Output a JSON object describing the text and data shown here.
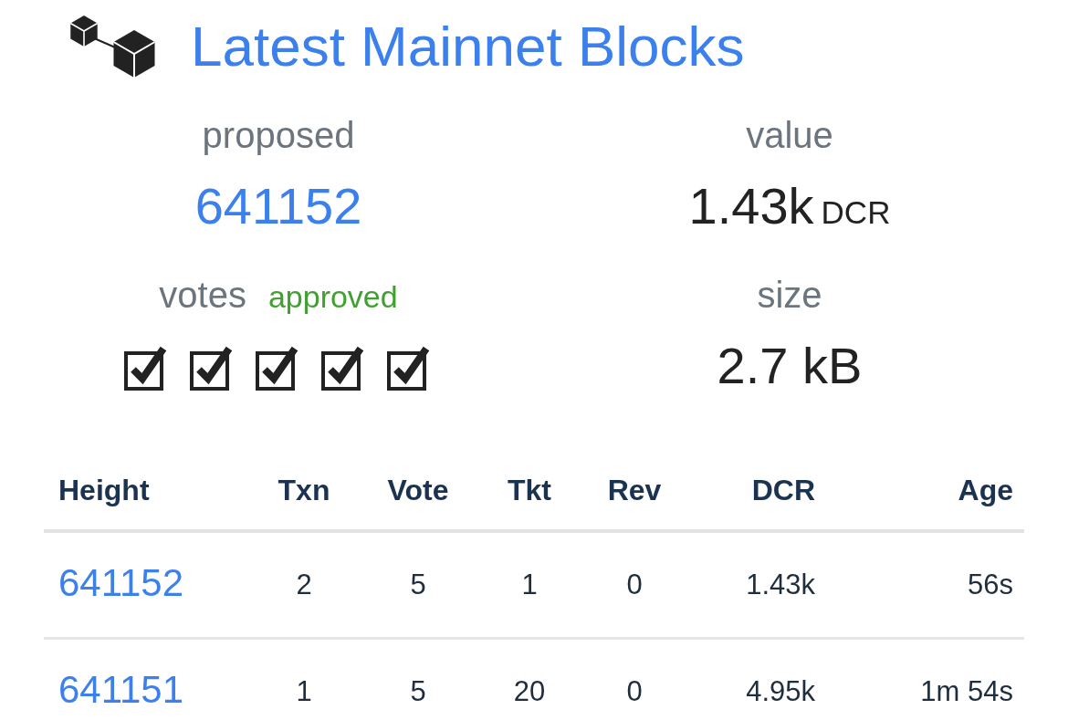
{
  "header": {
    "title": "Latest Mainnet Blocks"
  },
  "summary": {
    "proposed": {
      "label": "proposed",
      "value": "641152"
    },
    "value": {
      "label": "value",
      "amount": "1.43k",
      "unit": "DCR"
    },
    "votes": {
      "label": "votes",
      "status": "approved",
      "checks": [
        {
          "checked": true
        },
        {
          "checked": true
        },
        {
          "checked": true
        },
        {
          "checked": true
        },
        {
          "checked": true
        }
      ]
    },
    "size": {
      "label": "size",
      "value": "2.7 kB"
    }
  },
  "table": {
    "columns": [
      "Height",
      "Txn",
      "Vote",
      "Tkt",
      "Rev",
      "DCR",
      "Age"
    ],
    "rows": [
      [
        "641152",
        "2",
        "5",
        "1",
        "0",
        "1.43k",
        "56s"
      ],
      [
        "641151",
        "1",
        "5",
        "20",
        "0",
        "4.95k",
        "1m 54s"
      ]
    ]
  }
}
